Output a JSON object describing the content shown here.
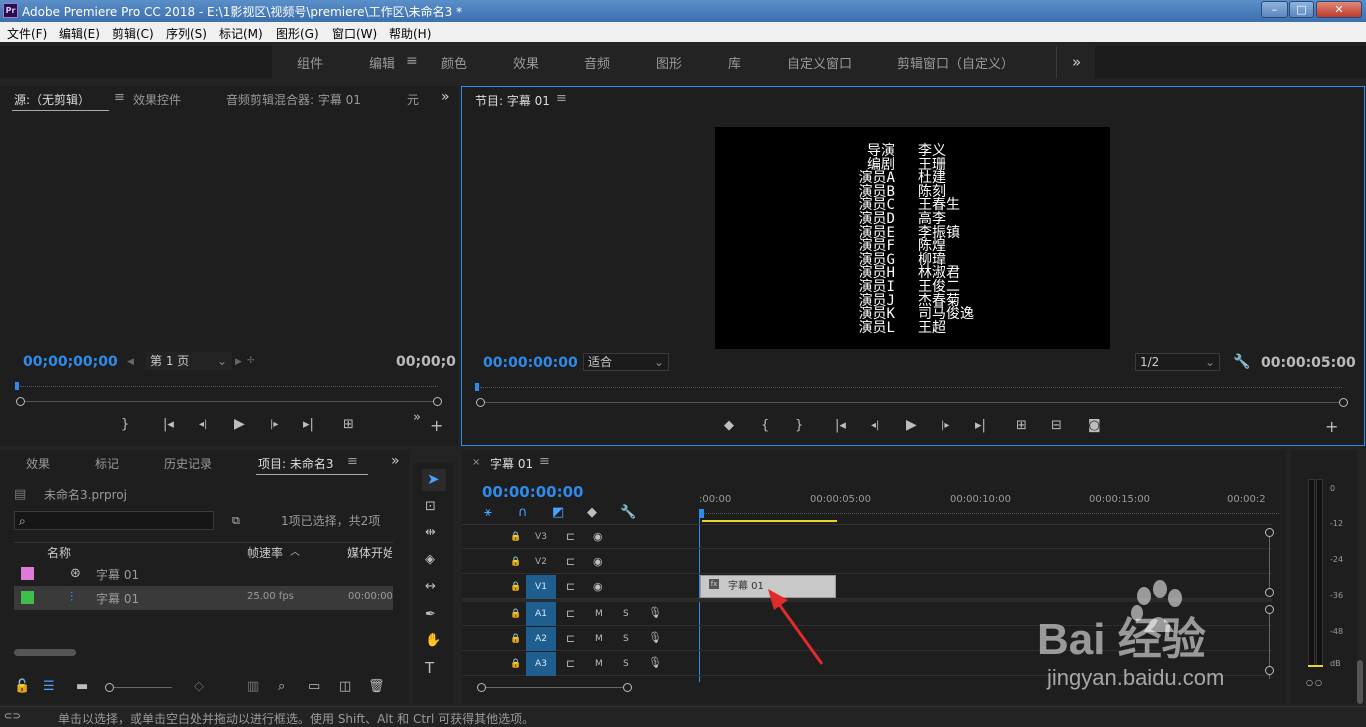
{
  "window": {
    "title": "Adobe Premiere Pro CC 2018 - E:\\1影视区\\视频号\\premiere\\工作区\\未命名3 *",
    "logo": "Pr"
  },
  "menu": [
    "文件(F)",
    "编辑(E)",
    "剪辑(C)",
    "序列(S)",
    "标记(M)",
    "图形(G)",
    "窗口(W)",
    "帮助(H)"
  ],
  "workspaces": {
    "items": [
      "组件",
      "编辑",
      "颜色",
      "效果",
      "音频",
      "图形",
      "库",
      "自定义窗口",
      "剪辑窗口（自定义）"
    ],
    "active": "编辑",
    "more": "»"
  },
  "source": {
    "tabs": [
      "源:（无剪辑）",
      "效果控件",
      "音频剪辑混合器: 字幕 01",
      "元"
    ],
    "timecode_left": "00;00;00;00",
    "page": "第 1 页",
    "timecode_right": "00;00;0"
  },
  "program": {
    "tab": "节目: 字幕 01",
    "timecode_left": "00:00:00:00",
    "fit": "适合",
    "ratio": "1/2",
    "timecode_right": "00:00:05:00",
    "credits": [
      [
        "导演",
        "李义"
      ],
      [
        "编剧",
        "王珊"
      ],
      [
        "演员A",
        "杜建"
      ],
      [
        "演员B",
        "陈刻"
      ],
      [
        "演员C",
        "王春生"
      ],
      [
        "演员D",
        "高李"
      ],
      [
        "演员E",
        "李振镇"
      ],
      [
        "演员F",
        "陈煌"
      ],
      [
        "演员G",
        "柳瑋"
      ],
      [
        "演员H",
        "林淑君"
      ],
      [
        "演员I",
        "王俊二"
      ],
      [
        "演员J",
        "杰春菊"
      ],
      [
        "演员K",
        "司马俊逸"
      ],
      [
        "演员L",
        "王超"
      ]
    ]
  },
  "project": {
    "tabs": [
      "效果",
      "标记",
      "历史记录",
      "项目: 未命名3"
    ],
    "file": "未命名3.prproj",
    "selection": "1项已选择，共2项",
    "columns": [
      "名称",
      "帧速率",
      "媒体开始"
    ],
    "items": [
      {
        "name": "字幕 01",
        "color": "#e07ad8",
        "fps": "",
        "start": ""
      },
      {
        "name": "字幕 01",
        "color": "#3fbf4a",
        "fps": "25.00 fps",
        "start": "00:00:00:"
      }
    ]
  },
  "timeline": {
    "tab": "字幕 01",
    "timecode": "00:00:00:00",
    "ruler": [
      ":00:00",
      "00:00:05:00",
      "00:00:10:00",
      "00:00:15:00",
      "00:00:2"
    ],
    "video_tracks": [
      "V3",
      "V2",
      "V1"
    ],
    "audio_tracks": [
      "A1",
      "A2",
      "A3"
    ],
    "clip": "字幕 01"
  },
  "meter": {
    "labels": [
      "0",
      "-12",
      "-24",
      "-36",
      "-48",
      "dB"
    ]
  },
  "status": "单击以选择，或单击空白处并拖动以进行框选。使用 Shift、Alt 和 Ctrl 可获得其他选项。",
  "watermark": {
    "brand": "Bai 经验",
    "url": "jingyan.baidu.com"
  },
  "colors": {
    "accent": "#2d8ceb",
    "bg": "#232323",
    "panel": "#1e1e1e"
  }
}
